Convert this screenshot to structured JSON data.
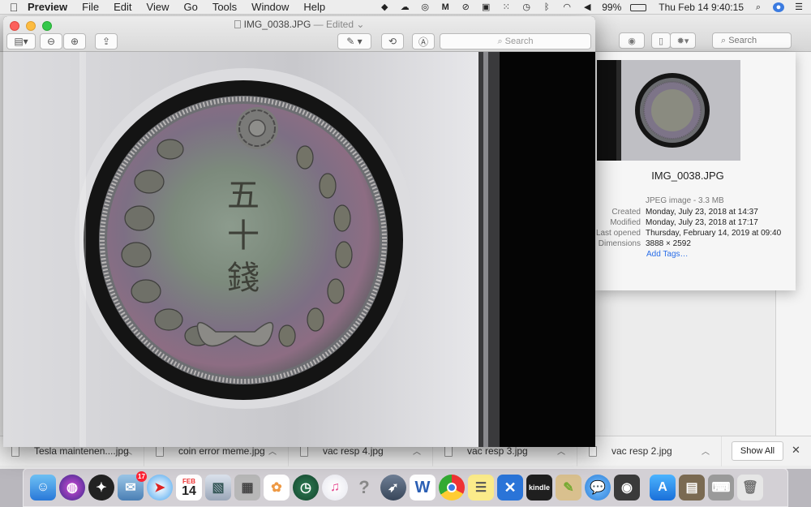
{
  "menubar": {
    "apple": "",
    "app": "Preview",
    "items": [
      "File",
      "Edit",
      "View",
      "Go",
      "Tools",
      "Window",
      "Help"
    ],
    "battery": "99%",
    "clock": "Thu Feb 14  9:40:15"
  },
  "preview": {
    "filename": "IMG_0038.JPG",
    "edited": "— Edited",
    "search_placeholder": "Search",
    "coin_text": [
      "五",
      "十",
      "錢"
    ]
  },
  "background_window": {
    "search_placeholder": "Search"
  },
  "info": {
    "filename": "IMG_0038.JPG",
    "kind": "JPEG image - 3.3 MB",
    "rows": [
      {
        "label": "Created",
        "value": "Monday, July 23, 2018 at 14:37"
      },
      {
        "label": "Modified",
        "value": "Monday, July 23, 2018 at 17:17"
      },
      {
        "label": "Last opened",
        "value": "Thursday, February 14, 2019 at 09:40"
      },
      {
        "label": "Dimensions",
        "value": "3888 × 2592"
      }
    ],
    "add_tags": "Add Tags…"
  },
  "downloads": {
    "items": [
      "Tesla maintenen....jpg",
      "coin error meme.jpg",
      "vac resp 4.jpg",
      "vac resp 3.jpg",
      "vac resp 2.jpg"
    ],
    "show_all": "Show All"
  },
  "dock": {
    "calendar_month": "FEB",
    "calendar_day": "14",
    "mail_badge": "17",
    "kindle_label": "kindle"
  },
  "colors": {
    "accent": "#2a6ee8",
    "close": "#fc605c",
    "minimize": "#fdbc40",
    "maximize": "#34c84a"
  }
}
